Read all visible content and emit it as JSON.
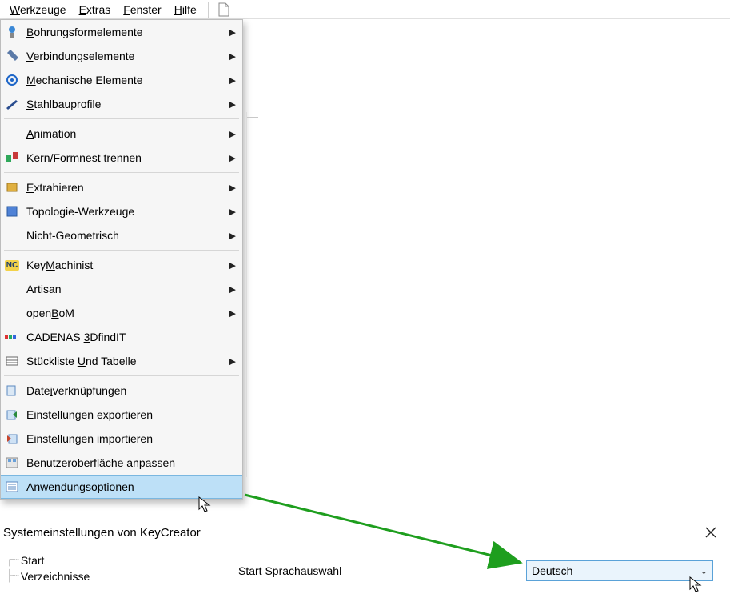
{
  "menubar": {
    "items": [
      {
        "label": "Werkzeuge",
        "mn": "W"
      },
      {
        "label": "Extras",
        "mn": "E"
      },
      {
        "label": "Fenster",
        "mn": "F"
      },
      {
        "label": "Hilfe",
        "mn": "H"
      }
    ]
  },
  "dropdown": {
    "groups": [
      [
        {
          "icon": "drill-icon",
          "label": "Bohrungsformelemente",
          "mn": "B",
          "sub": true
        },
        {
          "icon": "screw-icon",
          "label": "Verbindungselemente",
          "mn": "V",
          "sub": true
        },
        {
          "icon": "gear-icon",
          "label": "Mechanische Elemente",
          "mn": "M",
          "sub": true
        },
        {
          "icon": "beam-icon",
          "label": "Stahlbauprofile",
          "mn": "S",
          "sub": true
        }
      ],
      [
        {
          "icon": "",
          "label": "Animation",
          "mn": "A",
          "sub": true
        },
        {
          "icon": "mold-icon",
          "label": "Kern/Formnest trennen",
          "mn": "t",
          "sub": true
        }
      ],
      [
        {
          "icon": "extract-icon",
          "label": "Extrahieren",
          "mn": "E",
          "sub": true
        },
        {
          "icon": "topo-icon",
          "label": "Topologie-Werkzeuge",
          "mn": "",
          "sub": true
        },
        {
          "icon": "",
          "label": "Nicht-Geometrisch",
          "mn": "",
          "sub": true
        }
      ],
      [
        {
          "icon": "nc-icon",
          "label": "KeyMachinist",
          "mn": "M",
          "sub": true
        },
        {
          "icon": "",
          "label": "Artisan",
          "mn": "",
          "sub": true
        },
        {
          "icon": "",
          "label": "openBoM",
          "mn": "B",
          "sub": true
        },
        {
          "icon": "cadenas-icon",
          "label": "CADENAS 3DfindIT",
          "mn": "3",
          "sub": false
        },
        {
          "icon": "bom-icon",
          "label": "Stückliste Und Tabelle",
          "mn": "U",
          "sub": true
        }
      ],
      [
        {
          "icon": "link-icon",
          "label": "Dateiverknüpfungen",
          "mn": "i",
          "sub": false
        },
        {
          "icon": "export-icon",
          "label": "Einstellungen exportieren",
          "mn": "",
          "sub": false
        },
        {
          "icon": "import-icon",
          "label": "Einstellungen importieren",
          "mn": "",
          "sub": false
        },
        {
          "icon": "ui-icon",
          "label": "Benutzeroberfläche anpassen",
          "mn": "p",
          "sub": false
        },
        {
          "icon": "options-icon",
          "label": "Anwendungsoptionen",
          "mn": "A",
          "sub": false,
          "highlight": true
        }
      ]
    ]
  },
  "dialog": {
    "title": "Systemeinstellungen von KeyCreator",
    "tree": [
      {
        "label": "Start"
      },
      {
        "label": "Verzeichnisse"
      }
    ],
    "field_label": "Start Sprachauswahl",
    "combo_value": "Deutsch"
  }
}
